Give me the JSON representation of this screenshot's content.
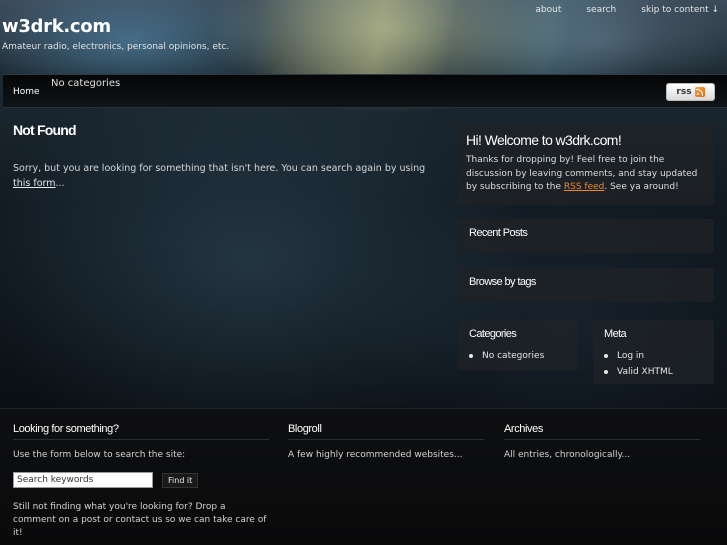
{
  "header": {
    "site_title": "w3drk.com",
    "site_description": "Amateur radio, electronics, personal opinions, etc.",
    "top_links": [
      "about",
      "search",
      "skip to content ↓"
    ]
  },
  "nav": {
    "home": "Home",
    "categories_text": "No categories",
    "rss_label": "rss"
  },
  "main": {
    "title": "Not Found",
    "text_before": "Sorry, but you are looking for something that isn't here. You can search again by using ",
    "link_text": "this form",
    "text_after": "..."
  },
  "sidebar": {
    "welcome_title": "Hi! Welcome to w3drk.com!",
    "welcome_text_1": "Thanks for dropping by! Feel free to join the discussion by leaving comments, and stay updated by subscribing to the ",
    "welcome_link": "RSS feed",
    "welcome_text_2": ". See ya around!",
    "recent_posts_title": "Recent Posts",
    "browse_tags_title": "Browse by tags",
    "categories_title": "Categories",
    "categories_items": [
      "No categories"
    ],
    "meta_title": "Meta",
    "meta_items": [
      "Log in",
      "Valid XHTML"
    ]
  },
  "footer": {
    "search_title": "Looking for something?",
    "search_text": "Use the form below to search the site:",
    "search_placeholder": "Search keywords",
    "find_button": "Find it",
    "search_note": "Still not finding what you're looking for? Drop a comment on a post or contact us so we can take care of it!",
    "blogroll_title": "Blogroll",
    "blogroll_text": "A few highly recommended websites...",
    "archives_title": "Archives",
    "archives_text": "All entries, chronologically..."
  },
  "colors": {
    "accent_link": "#f08a30",
    "rss_orange": "#e06a10"
  },
  "icons": [
    "rss-feed-icon"
  ]
}
